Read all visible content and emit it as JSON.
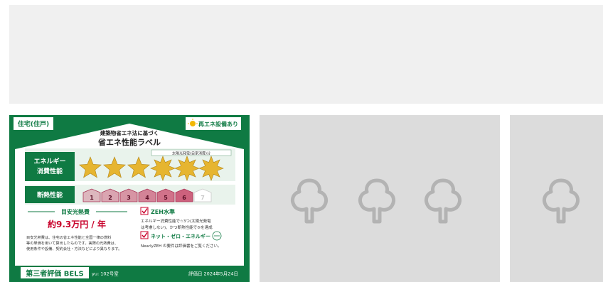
{
  "label": {
    "category": "住宅(住戸)",
    "renewable_badge": "再エネ設備あり",
    "title_small": "建築物省エネ法に基づく",
    "title_large": "省エネ性能ラベル",
    "solar_note": "太陽光発電(自家消費)分",
    "energy_label_line1": "エネルギー",
    "energy_label_line2": "消費性能",
    "energy_stars": {
      "solid": 3,
      "burst": 3
    },
    "insulation_label": "断熱性能",
    "insulation_grades": [
      "1",
      "2",
      "3",
      "4",
      "5",
      "6",
      "7"
    ],
    "insulation_active": 6,
    "cost_heading": "目安光熱費",
    "cost_value": "約9.3万円 / 年",
    "cost_note_1": "目安光熱費は、住宅の省エネ性能と全国一律の燃料",
    "cost_note_2": "等の単価を用いて算出したものです。実際の光熱費は、",
    "cost_note_3": "使用条件や設備、契約会社・方法などにより異なります。",
    "zeh_heading": "ZEH水準",
    "zeh_line1": "エネルギー消費性能で☆3つ(太陽光発電",
    "zeh_line2": "は考慮しない)、かつ断熱性能で⑤を達成",
    "netzero_heading": "ネット・ゼロ・エネルギー",
    "netzero_note": "NearlyZEH の要件は評価書をご覧ください。",
    "evaluator": "第三者評価 BELS",
    "room": "yu: 102号室",
    "date": "評価日 2024年5月24日"
  },
  "colors": {
    "green": "#0f7a43",
    "star": "#e6b530",
    "grade": "#c8476a"
  },
  "placeholders": [
    {
      "icon": "tree-icon",
      "count": 3
    },
    {
      "icon": "tree-icon",
      "count": 1
    }
  ]
}
